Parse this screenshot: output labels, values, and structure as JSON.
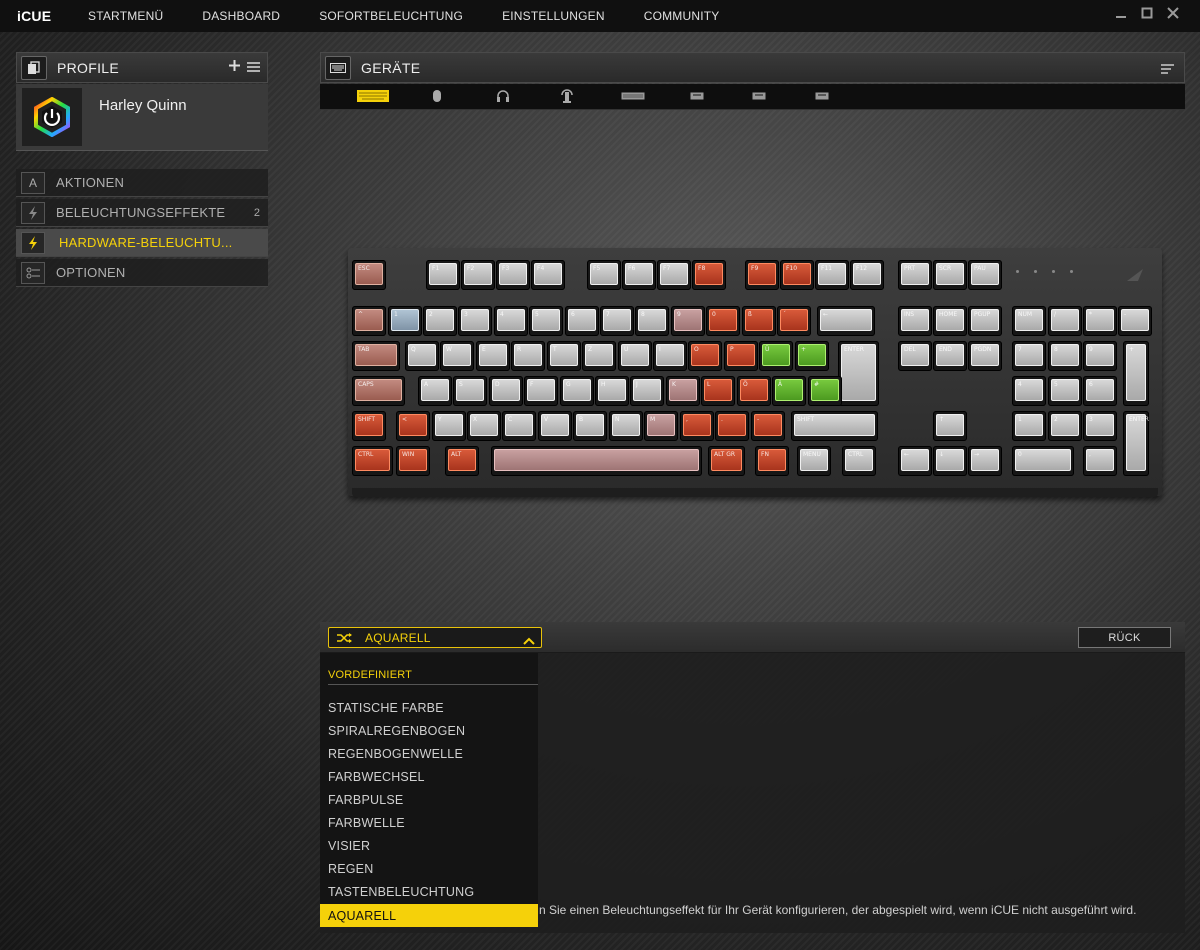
{
  "app": {
    "logo": "iCUE",
    "nav": [
      "STARTMENÜ",
      "DASHBOARD",
      "SOFORTBELEUCHTUNG",
      "EINSTELLUNGEN",
      "COMMUNITY"
    ],
    "window_controls": [
      "minimize-icon",
      "maximize-icon",
      "close-icon"
    ]
  },
  "profiles": {
    "title": "PROFILE",
    "add_icon": "plus-icon",
    "menu_icon": "hamburger-icon",
    "current": {
      "name": "Harley Quinn",
      "icon": "icue-rainbow-power-icon"
    }
  },
  "sidebar": {
    "items": [
      {
        "label": "AKTIONEN",
        "icon": "letter-a-icon",
        "count": ""
      },
      {
        "label": "BELEUCHTUNGSEFFEKTE",
        "icon": "lightning-icon",
        "count": "2"
      },
      {
        "label": "HARDWARE-BELEUCHTU...",
        "icon": "lightning-icon",
        "count": "",
        "active": true
      },
      {
        "label": "OPTIONEN",
        "icon": "sliders-icon",
        "count": ""
      }
    ]
  },
  "devices": {
    "title": "GERÄTE",
    "menu_icon": "list-icon",
    "tabs": [
      "keyboard-icon",
      "mouse-icon",
      "headset-icon",
      "headset-stand-icon",
      "keyboard-tenkeyless-icon",
      "device-icon",
      "device-icon",
      "device-icon"
    ],
    "active_tab": 0
  },
  "keyboard": {
    "rows": [
      [
        [
          "ESC",
          "p"
        ],
        [
          "F1",
          "w"
        ],
        [
          "F2",
          "w"
        ],
        [
          "F3",
          "w"
        ],
        [
          "F4",
          "w"
        ],
        [
          "F5",
          "w"
        ],
        [
          "F6",
          "w"
        ],
        [
          "F7",
          "w"
        ],
        [
          "F8",
          "r"
        ],
        [
          "F9",
          "r"
        ],
        [
          "F10",
          "r"
        ],
        [
          "F11",
          "w"
        ],
        [
          "F12",
          "w"
        ],
        [
          "PRT",
          "w"
        ],
        [
          "SCR",
          "w"
        ],
        [
          "PAU",
          "w"
        ]
      ],
      [
        [
          "^",
          "p"
        ],
        [
          "1",
          "b"
        ],
        [
          "2",
          "w"
        ],
        [
          "3",
          "w"
        ],
        [
          "4",
          "w"
        ],
        [
          "5",
          "w"
        ],
        [
          "6",
          "w"
        ],
        [
          "7",
          "w"
        ],
        [
          "8",
          "w"
        ],
        [
          "9",
          "s"
        ],
        [
          "0",
          "r"
        ],
        [
          "ß",
          "r"
        ],
        [
          "´",
          "r"
        ],
        [
          "←",
          "w"
        ],
        [
          "INS",
          "w"
        ],
        [
          "HOME",
          "w"
        ],
        [
          "PGUP",
          "w"
        ],
        [
          "NUM",
          "w"
        ],
        [
          "/",
          "w"
        ],
        [
          "*",
          "w"
        ],
        [
          "-",
          "w"
        ]
      ],
      [
        [
          "TAB",
          "p"
        ],
        [
          "Q",
          "w"
        ],
        [
          "W",
          "w"
        ],
        [
          "E",
          "w"
        ],
        [
          "R",
          "w"
        ],
        [
          "T",
          "w"
        ],
        [
          "Z",
          "w"
        ],
        [
          "U",
          "w"
        ],
        [
          "I",
          "w"
        ],
        [
          "O",
          "r"
        ],
        [
          "P",
          "r"
        ],
        [
          "Ü",
          "g"
        ],
        [
          "+",
          "g"
        ],
        [
          "ENTER",
          "w"
        ],
        [
          "DEL",
          "w"
        ],
        [
          "END",
          "w"
        ],
        [
          "PGDN",
          "w"
        ],
        [
          "7",
          "w"
        ],
        [
          "8",
          "w"
        ],
        [
          "9",
          "w"
        ],
        [
          "+",
          "w"
        ]
      ],
      [
        [
          "CAPS",
          "p"
        ],
        [
          "A",
          "w"
        ],
        [
          "S",
          "w"
        ],
        [
          "D",
          "w"
        ],
        [
          "F",
          "w"
        ],
        [
          "G",
          "w"
        ],
        [
          "H",
          "w"
        ],
        [
          "J",
          "w"
        ],
        [
          "K",
          "s"
        ],
        [
          "L",
          "r"
        ],
        [
          "Ö",
          "r"
        ],
        [
          "Ä",
          "g"
        ],
        [
          "#",
          "g"
        ],
        [
          "4",
          "w"
        ],
        [
          "5",
          "w"
        ],
        [
          "6",
          "w"
        ]
      ],
      [
        [
          "SHIFT",
          "r"
        ],
        [
          "<",
          "r"
        ],
        [
          "Y",
          "w"
        ],
        [
          "X",
          "w"
        ],
        [
          "C",
          "w"
        ],
        [
          "V",
          "w"
        ],
        [
          "B",
          "w"
        ],
        [
          "N",
          "w"
        ],
        [
          "M",
          "s"
        ],
        [
          ",",
          "r"
        ],
        [
          ".",
          "r"
        ],
        [
          "-",
          "r"
        ],
        [
          "SHIFT",
          "w"
        ],
        [
          "↑",
          "w"
        ],
        [
          "1",
          "w"
        ],
        [
          "2",
          "w"
        ],
        [
          "3",
          "w"
        ],
        [
          "ENTER",
          "w"
        ]
      ],
      [
        [
          "CTRL",
          "r"
        ],
        [
          "WIN",
          "r"
        ],
        [
          "ALT",
          "r"
        ],
        [
          "",
          "s"
        ],
        [
          "ALT GR",
          "r"
        ],
        [
          "FN",
          "r"
        ],
        [
          "MENU",
          "w"
        ],
        [
          "CTRL",
          "w"
        ],
        [
          "←",
          "w"
        ],
        [
          "↓",
          "w"
        ],
        [
          "→",
          "w"
        ],
        [
          "0",
          "w"
        ],
        [
          ",",
          "w"
        ]
      ]
    ]
  },
  "effect": {
    "selected": "AQUARELL",
    "shuffle_icon": "shuffle-icon",
    "chevron_icon": "chevron-up-icon",
    "back_label": "RÜCK",
    "info": "n Sie einen Beleuchtungseffekt für Ihr Gerät konfigurieren, der abgespielt wird, wenn iCUE nicht ausgeführt wird."
  },
  "dropdown": {
    "section": "VORDEFINIERT",
    "items": [
      "STATISCHE FARBE",
      "SPIRALREGENBOGEN",
      "REGENBOGENWELLE",
      "FARBWECHSEL",
      "FARBPULSE",
      "FARBWELLE",
      "VISIER",
      "REGEN",
      "TASTENBELEUCHTUNG",
      "AQUARELL"
    ],
    "selected_index": 9
  },
  "colors": {
    "accent": "#f5d10a",
    "key_red": "#c8482a",
    "key_green": "#6cbf36",
    "key_white": "#cfcfcf"
  }
}
